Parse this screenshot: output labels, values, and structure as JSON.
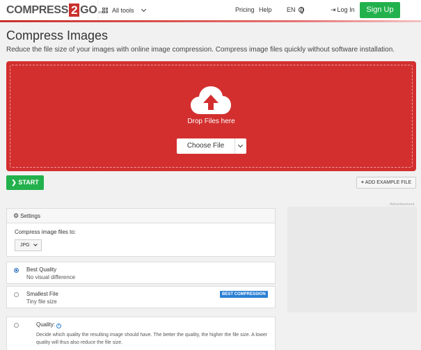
{
  "header": {
    "logo_main": "COMPRESS",
    "logo_num": "2",
    "logo_go": "GO",
    "logo_suffix": ".com",
    "all_tools": "All tools",
    "pricing": "Pricing",
    "help": "Help",
    "language": "EN",
    "login": "Log In",
    "signup": "Sign Up"
  },
  "page": {
    "title": "Compress Images",
    "subtitle": "Reduce the file size of your images with online image compression. Compress image files quickly without software installation."
  },
  "upload": {
    "drop_text": "Drop Files here",
    "choose_file": "Choose File"
  },
  "actions": {
    "start": "START",
    "add_example": "ADD EXAMPLE FILE"
  },
  "ad": {
    "label": "Advertisement"
  },
  "settings": {
    "heading": "Settings",
    "compress_label": "Compress image files to:",
    "format_value": "JPG",
    "options": [
      {
        "title": "Best Quality",
        "desc": "No visual difference",
        "selected": true
      },
      {
        "title": "Smallest File",
        "desc": "Tiny file size",
        "badge": "BEST COMPRESSION",
        "selected": false
      },
      {
        "title": "Quality:",
        "desc": "Decide which quality the resulting image should have. The better the quality, the higher the file size. A lower quality will thus also reduce the file size.",
        "selected": false
      }
    ]
  },
  "colors": {
    "brand_red": "#d32f2f",
    "green": "#22b14c",
    "badge_blue": "#2a7fd4"
  }
}
